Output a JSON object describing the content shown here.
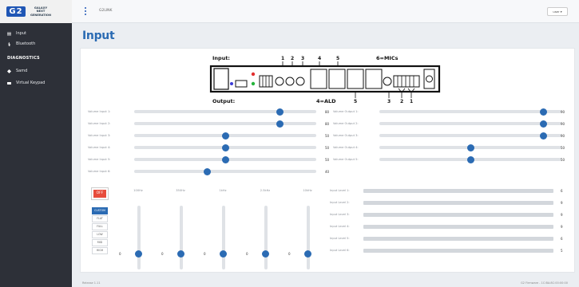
{
  "logo": {
    "mark": "G2",
    "lines": [
      "GALAXY",
      "NEXT",
      "GENERATION"
    ]
  },
  "sidebar": {
    "items": [
      {
        "label": "Input",
        "icon": "sliders-icon"
      },
      {
        "label": "Bluetooth",
        "icon": "bluetooth-icon"
      }
    ],
    "section_heading": "DIAGNOSTICS",
    "diag_items": [
      {
        "label": "Samd",
        "icon": "chip-icon"
      },
      {
        "label": "Virtual Keypad",
        "icon": "keyboard-icon"
      }
    ]
  },
  "topbar": {
    "device": "G2LINK",
    "user_label": "user ▾"
  },
  "page": {
    "title": "Input"
  },
  "diagram": {
    "input_label": "Input:",
    "output_label": "Output:",
    "mics_label": "6=MICs",
    "ald_label": "4=ALD",
    "badge": "1",
    "top_numbers": [
      "1",
      "2",
      "3",
      "4",
      "5"
    ],
    "bottom_numbers": [
      "5",
      "3",
      "2",
      "1"
    ]
  },
  "volume_inputs": [
    {
      "label": "Volume Input 1:",
      "value": 80
    },
    {
      "label": "Volume Input 2:",
      "value": 80
    },
    {
      "label": "Volume Input 3:",
      "value": 50
    },
    {
      "label": "Volume Input 4:",
      "value": 50
    },
    {
      "label": "Volume Input 5:",
      "value": 50
    },
    {
      "label": "Volume Input 6:",
      "value": 40
    }
  ],
  "volume_outputs": [
    {
      "label": "Volume Output 1:",
      "value": 90
    },
    {
      "label": "Volume Output 2:",
      "value": 90
    },
    {
      "label": "Volume Output 3:",
      "value": 90
    },
    {
      "label": "Volume Output 4:",
      "value": 50
    },
    {
      "label": "Volume Output 5:",
      "value": 50
    }
  ],
  "eq": {
    "power_label": "OFF",
    "presets": [
      "CUSTOM",
      "FLAT",
      "FULL",
      "LOW",
      "MID",
      "HIGH"
    ],
    "active_preset": "CUSTOM",
    "bands": [
      {
        "label": "100Hz",
        "value": 0
      },
      {
        "label": "350Hz",
        "value": 0
      },
      {
        "label": "1kHz",
        "value": 0
      },
      {
        "label": "2.5kHz",
        "value": 0
      },
      {
        "label": "10kHz",
        "value": 0
      }
    ]
  },
  "input_levels": [
    {
      "label": "Input Level 1:",
      "value": 6
    },
    {
      "label": "Input Level 2:",
      "value": 9
    },
    {
      "label": "Input Level 3:",
      "value": 9
    },
    {
      "label": "Input Level 4:",
      "value": 9
    },
    {
      "label": "Input Level 5:",
      "value": 6
    },
    {
      "label": "Input Level 6:",
      "value": 5
    }
  ],
  "footer": {
    "left": "Release 1.11",
    "right": "G2 Firmware - 1C:BA:8C:00:00:00"
  },
  "colors": {
    "accent": "#2b6bb3",
    "sidebar": "#2d3038",
    "off_button": "#e74c3c",
    "badge": "#e74c3c"
  }
}
